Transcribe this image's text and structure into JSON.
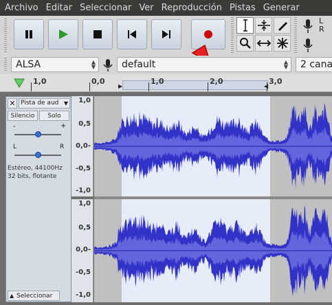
{
  "menu": [
    "Archivo",
    "Editar",
    "Seleccionar",
    "Ver",
    "Reproducción",
    "Pistas",
    "Generar"
  ],
  "transport": {
    "pause": "pause-icon",
    "play": "play-icon",
    "stop": "stop-icon",
    "skip_start": "skip-start-icon",
    "skip_end": "skip-end-icon",
    "record": "record-icon"
  },
  "tools": [
    "selection-tool-icon",
    "envelope-tool-icon",
    "draw-tool-icon",
    "zoom-tool-icon",
    "timeshift-tool-icon",
    "multi-tool-icon"
  ],
  "meters": {
    "rec_L": "L",
    "rec_R": "R"
  },
  "device": {
    "host": "ALSA",
    "input_device": "default",
    "channels": "2 cana"
  },
  "ruler": {
    "labels": [
      "1,0",
      "0,0",
      "1,0",
      "2,0",
      "3,0"
    ]
  },
  "track": {
    "name": "Pista de aud",
    "mute_label": "Silencio",
    "solo_label": "Solo",
    "gain_minus": "-",
    "gain_plus": "+",
    "pan_left": "L",
    "pan_right": "R",
    "info_line1": "Estéreo, 44100Hz",
    "info_line2": "32 bits, flotante",
    "select_label": "Seleccionar"
  },
  "scale": {
    "top": [
      "1,0",
      "0,5",
      "0,0-",
      "-0,5",
      "-1,0"
    ],
    "bottom": [
      "1,0",
      "0,5",
      "0,0-",
      "-0,5",
      "-1,0"
    ]
  },
  "colors": {
    "waveform": "#3232c8",
    "waveform_rms": "#6464dc",
    "selection_bg": "#e6ecf8",
    "unselected_bg": "#c0c0c0",
    "record_red": "#cc0000",
    "play_green": "#2a9a2a"
  }
}
